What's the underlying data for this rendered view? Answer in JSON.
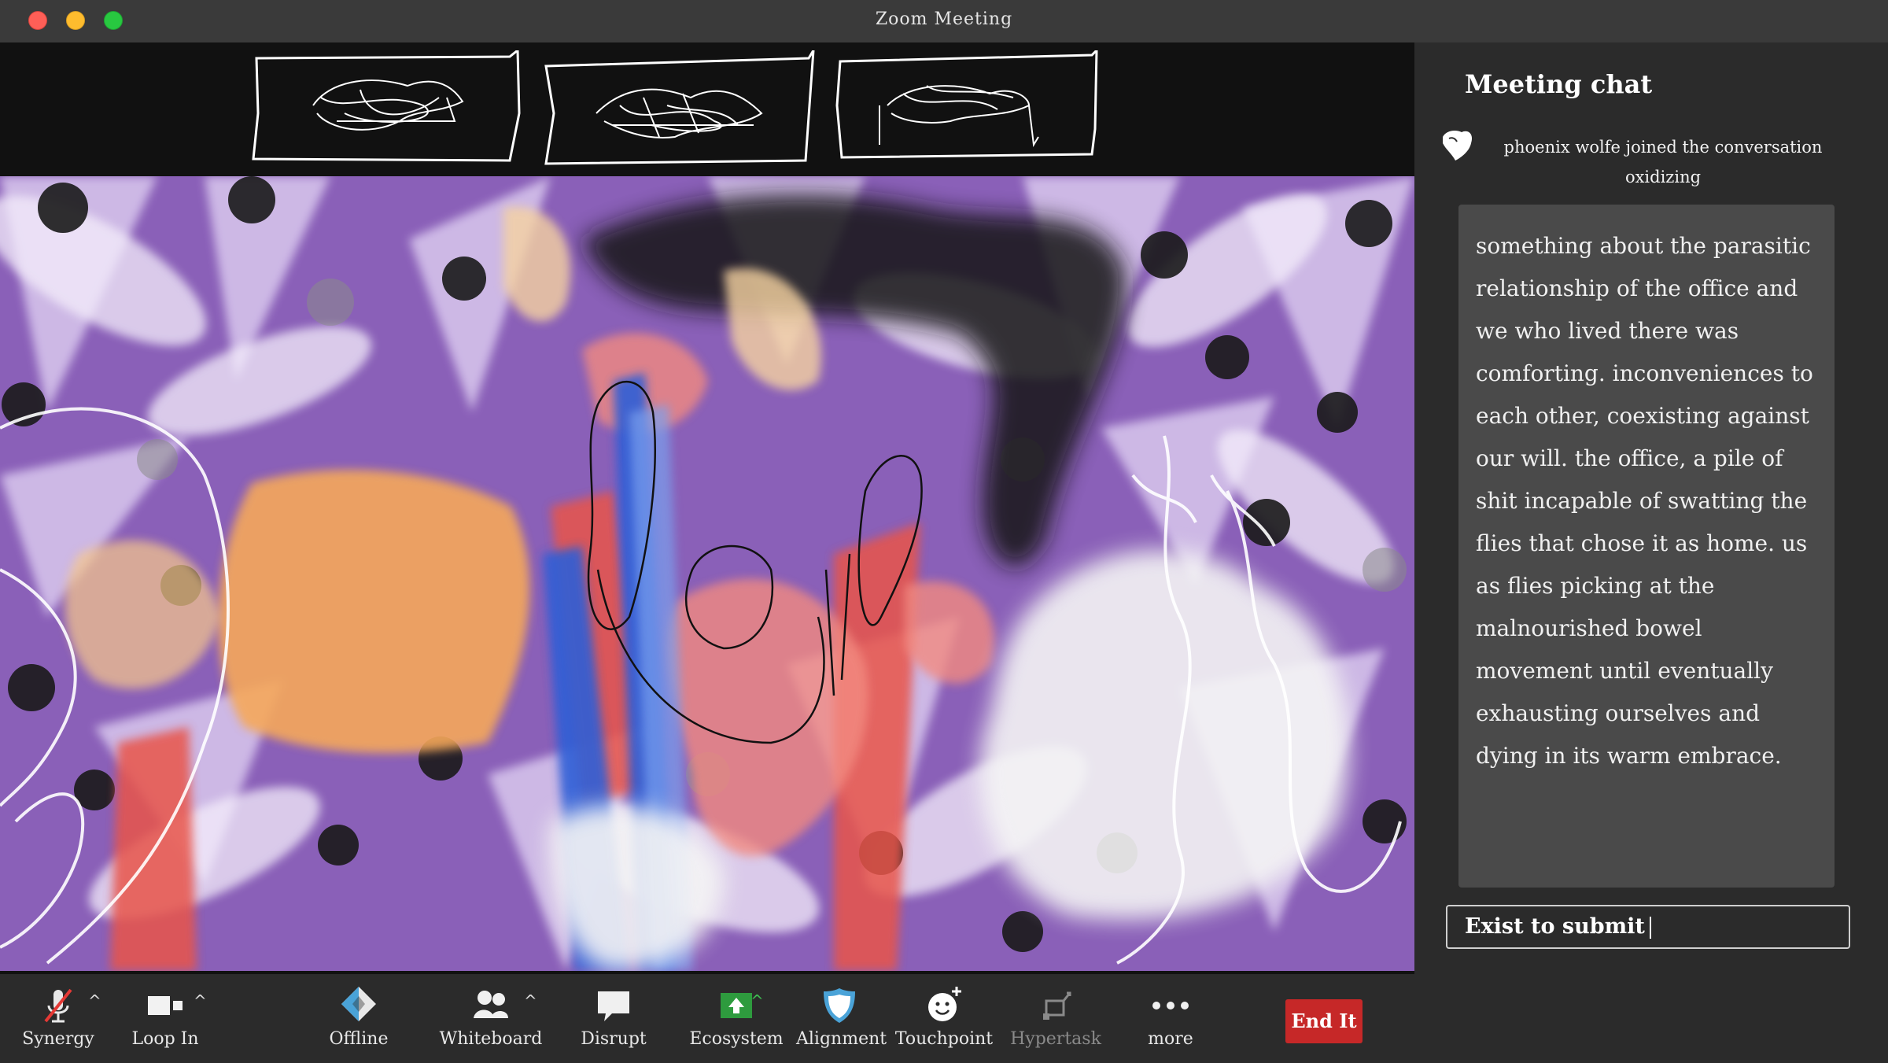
{
  "window": {
    "title": "Zoom Meeting"
  },
  "chat": {
    "title": "Meeting chat",
    "join_notice": "phoenix wolfe  joined the conversation",
    "join_status": "oxidizing",
    "message": "something about the parasitic relationship of the office and we who lived there was comforting. inconveniences to each other, coexisting against our will. the office, a pile of shit incapable of swatting the flies that chose it as home. us as flies picking at the malnourished bowel movement until eventually exhausting ourselves and dying in its warm embrace.",
    "input_placeholder": "Exist to submit"
  },
  "toolbar": {
    "synergy": "Synergy",
    "loop_in": "Loop In",
    "offline": "Offline",
    "whiteboard": "Whiteboard",
    "disrupt": "Disrupt",
    "ecosystem": "Ecosystem",
    "alignment": "Alignment",
    "touchpoint": "Touchpoint",
    "hypertask": "Hypertask",
    "more": "more",
    "end": "End It"
  },
  "colors": {
    "accent_red": "#c62828",
    "eco_green": "#2e9b3e",
    "alignment_blue": "#4aa3d8",
    "background": "#2b2b2b"
  },
  "icons": [
    "mic-muted-icon",
    "video-icon",
    "diamond-icon",
    "people-icon",
    "speech-bubble-icon",
    "share-arrow-icon",
    "shield-icon",
    "smiley-plus-icon",
    "hypertask-icon",
    "more-dots-icon",
    "hand-icon"
  ]
}
